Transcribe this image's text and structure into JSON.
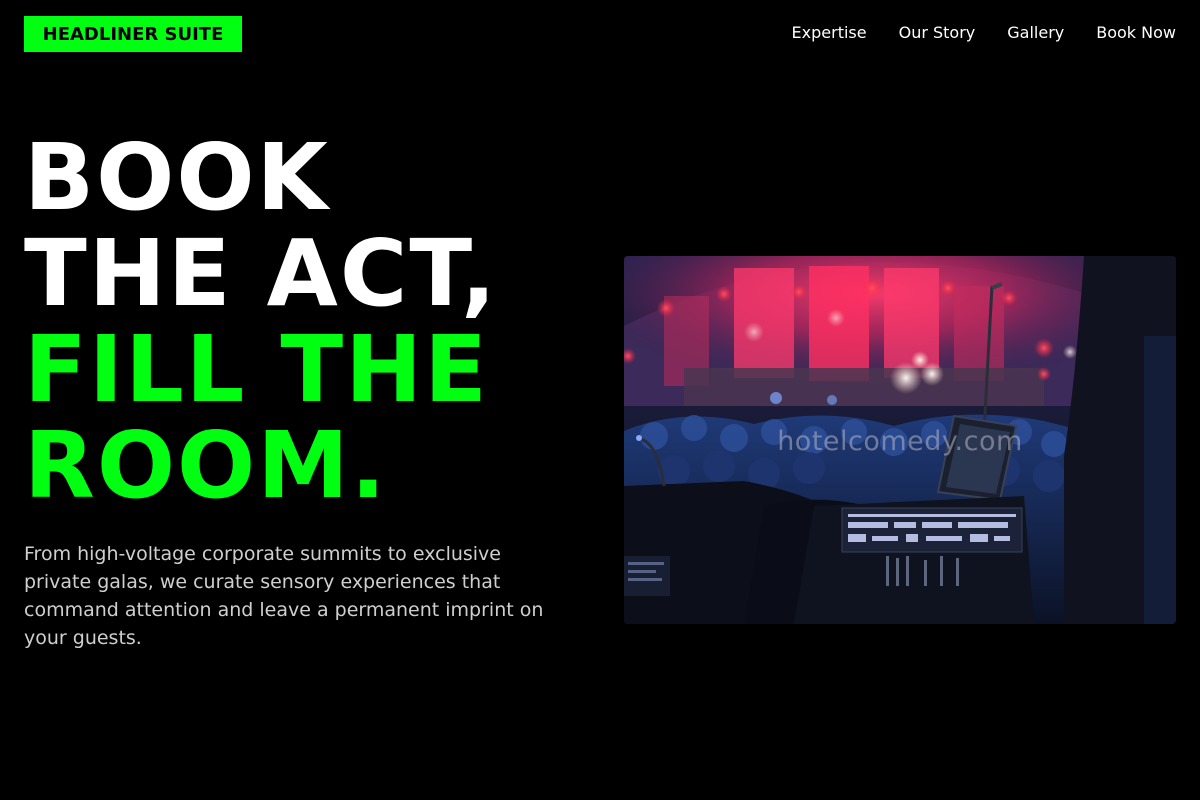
{
  "header": {
    "logo_text": "HEADLINER SUITE",
    "nav": [
      {
        "label": "Expertise"
      },
      {
        "label": "Our Story"
      },
      {
        "label": "Gallery"
      },
      {
        "label": "Book Now"
      }
    ]
  },
  "hero": {
    "headline_lines": [
      "BOOK",
      "THE ACT,",
      "FILL THE",
      "ROOM."
    ],
    "lede": "From high-voltage corporate summits to exclusive private galas, we curate sensory experiences that command attention and leave a permanent imprint on your guests.",
    "image_watermark": "hotelcomedy.com"
  },
  "colors": {
    "background": "#000000",
    "accent": "#00ff11",
    "text": "#ffffff",
    "muted_text": "#cfcfcf"
  }
}
